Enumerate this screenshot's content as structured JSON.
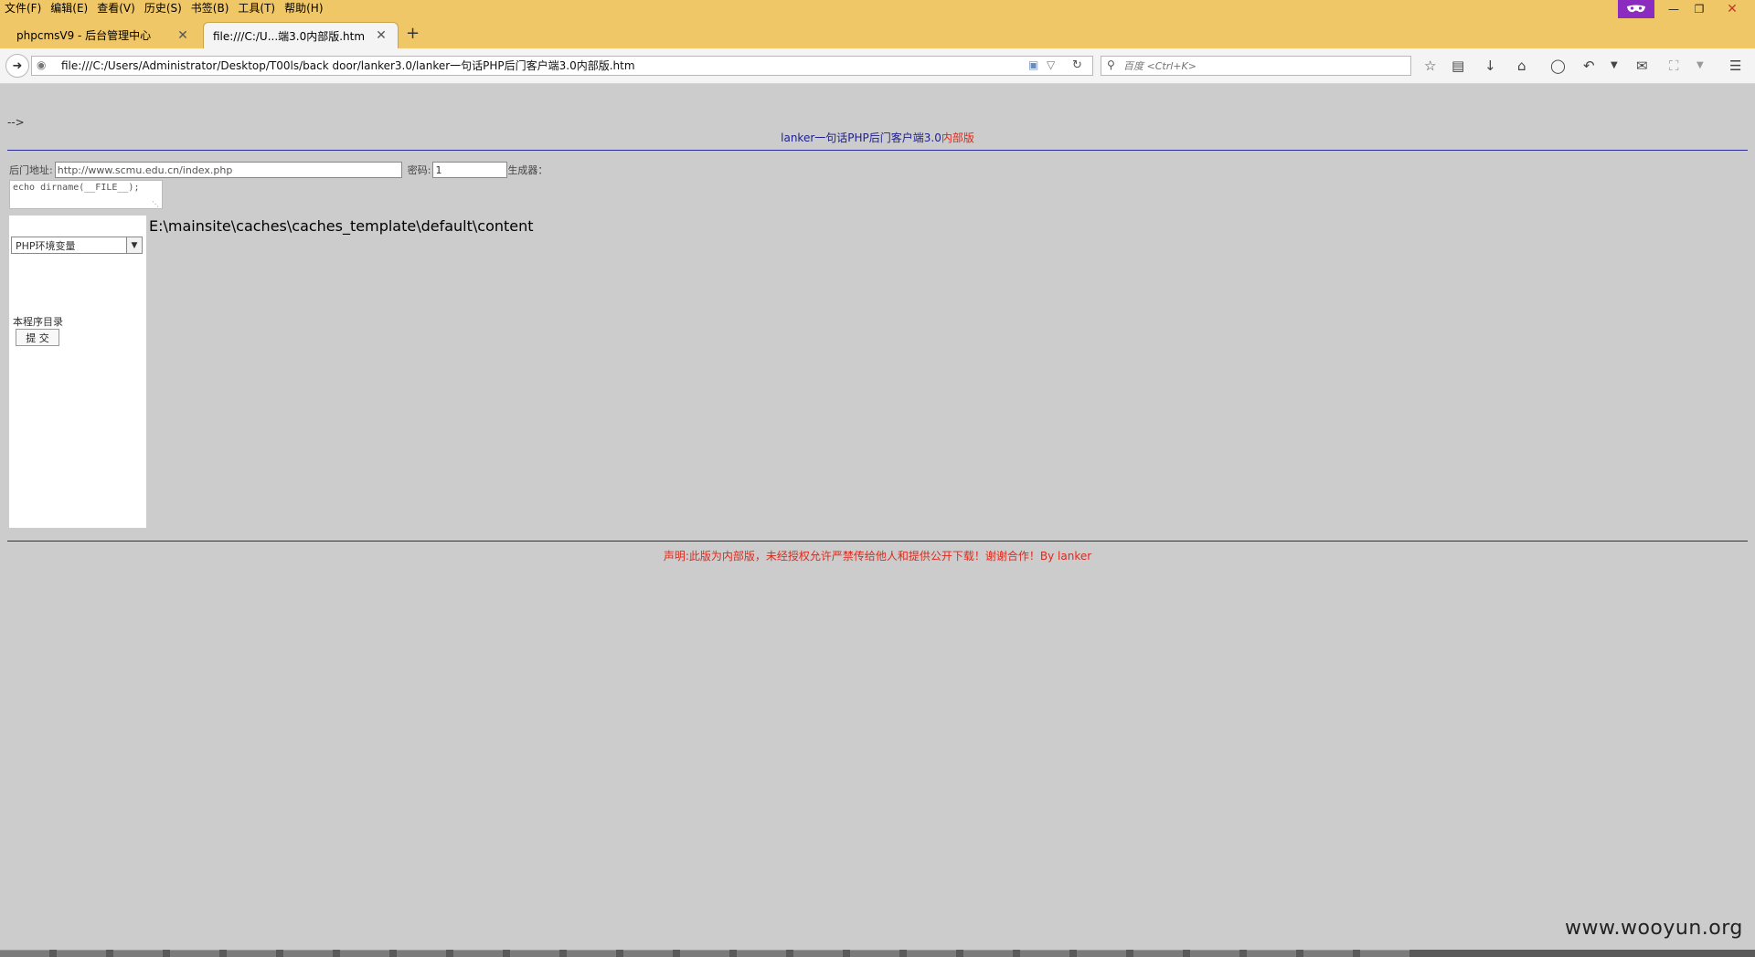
{
  "menubar": {
    "items": [
      "文件(F)",
      "编辑(E)",
      "查看(V)",
      "历史(S)",
      "书签(B)",
      "工具(T)",
      "帮助(H)"
    ]
  },
  "tabs": [
    {
      "label": "phpcmsV9 - 后台管理中心"
    },
    {
      "label": "file:///C:/U...端3.0内部版.htm"
    }
  ],
  "navbar": {
    "url": "file:///C:/Users/Administrator/Desktop/T00ls/back door/lanker3.0/lanker一句话PHP后门客户端3.0内部版.htm",
    "search_placeholder": "百度 <Ctrl+K>"
  },
  "page": {
    "comment": "-->",
    "title_main": "lanker一句话PHP后门客户端3.0",
    "title_red": "内部版",
    "backdoor_label": "后门地址:",
    "backdoor_value": "http://www.scmu.edu.cn/index.php",
    "password_label": "密码:",
    "password_value": "1",
    "generator_label": "生成器：",
    "code": "echo dirname(__FILE__);",
    "select_value": "PHP环境变量",
    "dir_label": "本程序目录",
    "submit_label": "提 交",
    "output": "E:\\mainsite\\caches\\caches_template\\default\\content",
    "footer": "声明:此版为内部版，未经授权允许严禁传给他人和提供公开下载！谢谢合作！By lanker"
  },
  "watermark": "www.wooyun.org",
  "colors": {
    "chrome": "#f0c767",
    "page_bg": "#cccccc",
    "title_blue": "#1e1e8c",
    "accent_red": "#e0281b",
    "private_badge": "#8c2bbf"
  }
}
